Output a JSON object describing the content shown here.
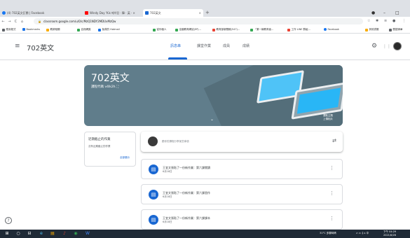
{
  "browser": {
    "tabs": [
      {
        "label": "(4) 702英文訂閱 | Facebook",
        "color": "#1877f2"
      },
      {
        "label": "Windy Day 'Kis 메이킹 · 韓 · 英 · ×",
        "color": "#ff0000"
      },
      {
        "label": "702英文",
        "color": "#1967d2"
      }
    ],
    "new_tab": "+",
    "window_controls": [
      "●",
      "–",
      "□"
    ],
    "nav": [
      "←",
      "→",
      "C",
      "⌂"
    ],
    "url": "classroom.google.com/u/0/c/MzQ1NDY2MDUxMzQw",
    "toolbar_icons": [
      "☆",
      "✱",
      "≡",
      "●",
      "⋮"
    ]
  },
  "bookmarks": [
    {
      "label": "應用程式",
      "color": "#5f6368"
    },
    {
      "label": "Bookmarks",
      "color": "#1a73e8"
    },
    {
      "label": "教師相關",
      "color": "#f9ab00"
    },
    {
      "label": "自然網頁",
      "color": "#34a853"
    },
    {
      "label": "免費的 Hotmail",
      "color": "#1a73e8"
    },
    {
      "label": "從你個人",
      "color": "#34a853"
    },
    {
      "label": "全國教育網站(EP)...",
      "color": "#34a853"
    },
    {
      "label": "教育部新聞稿(547)...",
      "color": "#ea4335"
    },
    {
      "label": "「第一線教育者...",
      "color": "#34a853"
    },
    {
      "label": "工作 LINE 群組...",
      "color": "#ea4335"
    },
    {
      "label": "Facebook",
      "color": "#1877f2"
    },
    {
      "label": "其他書籤",
      "color": "#f9ab00"
    },
    {
      "label": "閱讀清單",
      "color": "#5f6368"
    }
  ],
  "app": {
    "menu_icon": "≡",
    "title": "702英文",
    "tabs": [
      "訊息串",
      "課堂作業",
      "成員",
      "成績"
    ],
    "active_tab": 0,
    "gear_icon": "⚙",
    "apps_icon": "⋮⋮"
  },
  "banner": {
    "title": "702英文",
    "code_label": "課程代碼",
    "code": "v4lk2h",
    "code_icon": "⛶",
    "chevron": "⌄",
    "theme_line1": "選取主題",
    "theme_line2": "上傳相片",
    "bg": "#607d8b"
  },
  "upcoming": {
    "heading": "近期截止的作業",
    "text": "沒有近期截止的作業",
    "link": "全部顯示"
  },
  "share": {
    "placeholder": "跟你的課程分享某些事項",
    "repost_icon": "⇄"
  },
  "posts": [
    {
      "title": "王宜文張貼了一份新作業：第六課閱讀",
      "date": "6月18日"
    },
    {
      "title": "王宜文張貼了一份新作業：第六課習作",
      "date": "6月18日"
    },
    {
      "title": "王宜文張貼了一份新作業：第六課課本",
      "date": "6月18日"
    }
  ],
  "help_icon": "?",
  "taskbar": {
    "icons": [
      "⊞",
      "○",
      "⊟",
      "e",
      "▤",
      "♪",
      "◉",
      "W"
    ],
    "weather": "31°C 多雲時晴",
    "tray": "∧ ▭ 𝄞 ⌂ 中",
    "time": "下午 04:29",
    "date": "2021/6/26"
  }
}
